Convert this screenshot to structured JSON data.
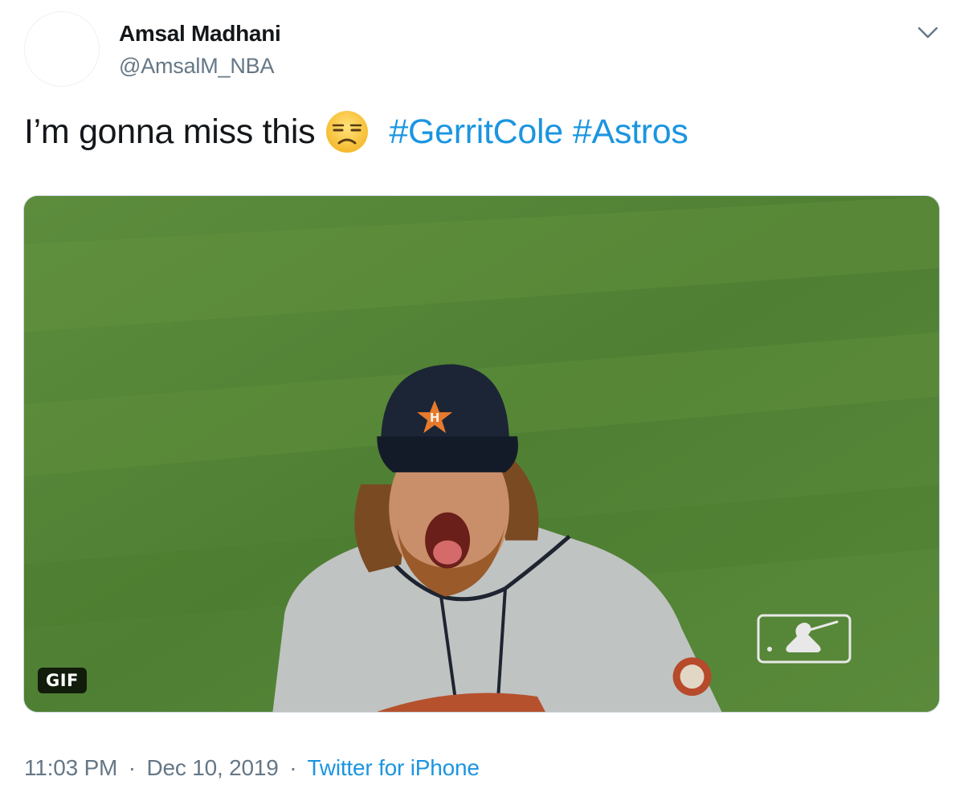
{
  "tweet": {
    "author_name": "Amsal Madhani",
    "author_handle": "@AmsalM_NBA",
    "text": "I’m gonna miss this",
    "emoji": "unamused-face-emoji",
    "hashtags": [
      "#GerritCole",
      "#Astros"
    ],
    "media": {
      "badge": "GIF",
      "watermark": "mlb-logo"
    },
    "time": "11:03 PM",
    "date": "Dec 10, 2019",
    "separator": "·",
    "source": "Twitter for iPhone"
  },
  "colors": {
    "text": "#14171a",
    "secondary": "#657786",
    "link": "#1b95e0",
    "grass": "#5b8a3a"
  },
  "icons": {
    "menu": "chevron-down-icon",
    "avatar": "avatar"
  }
}
